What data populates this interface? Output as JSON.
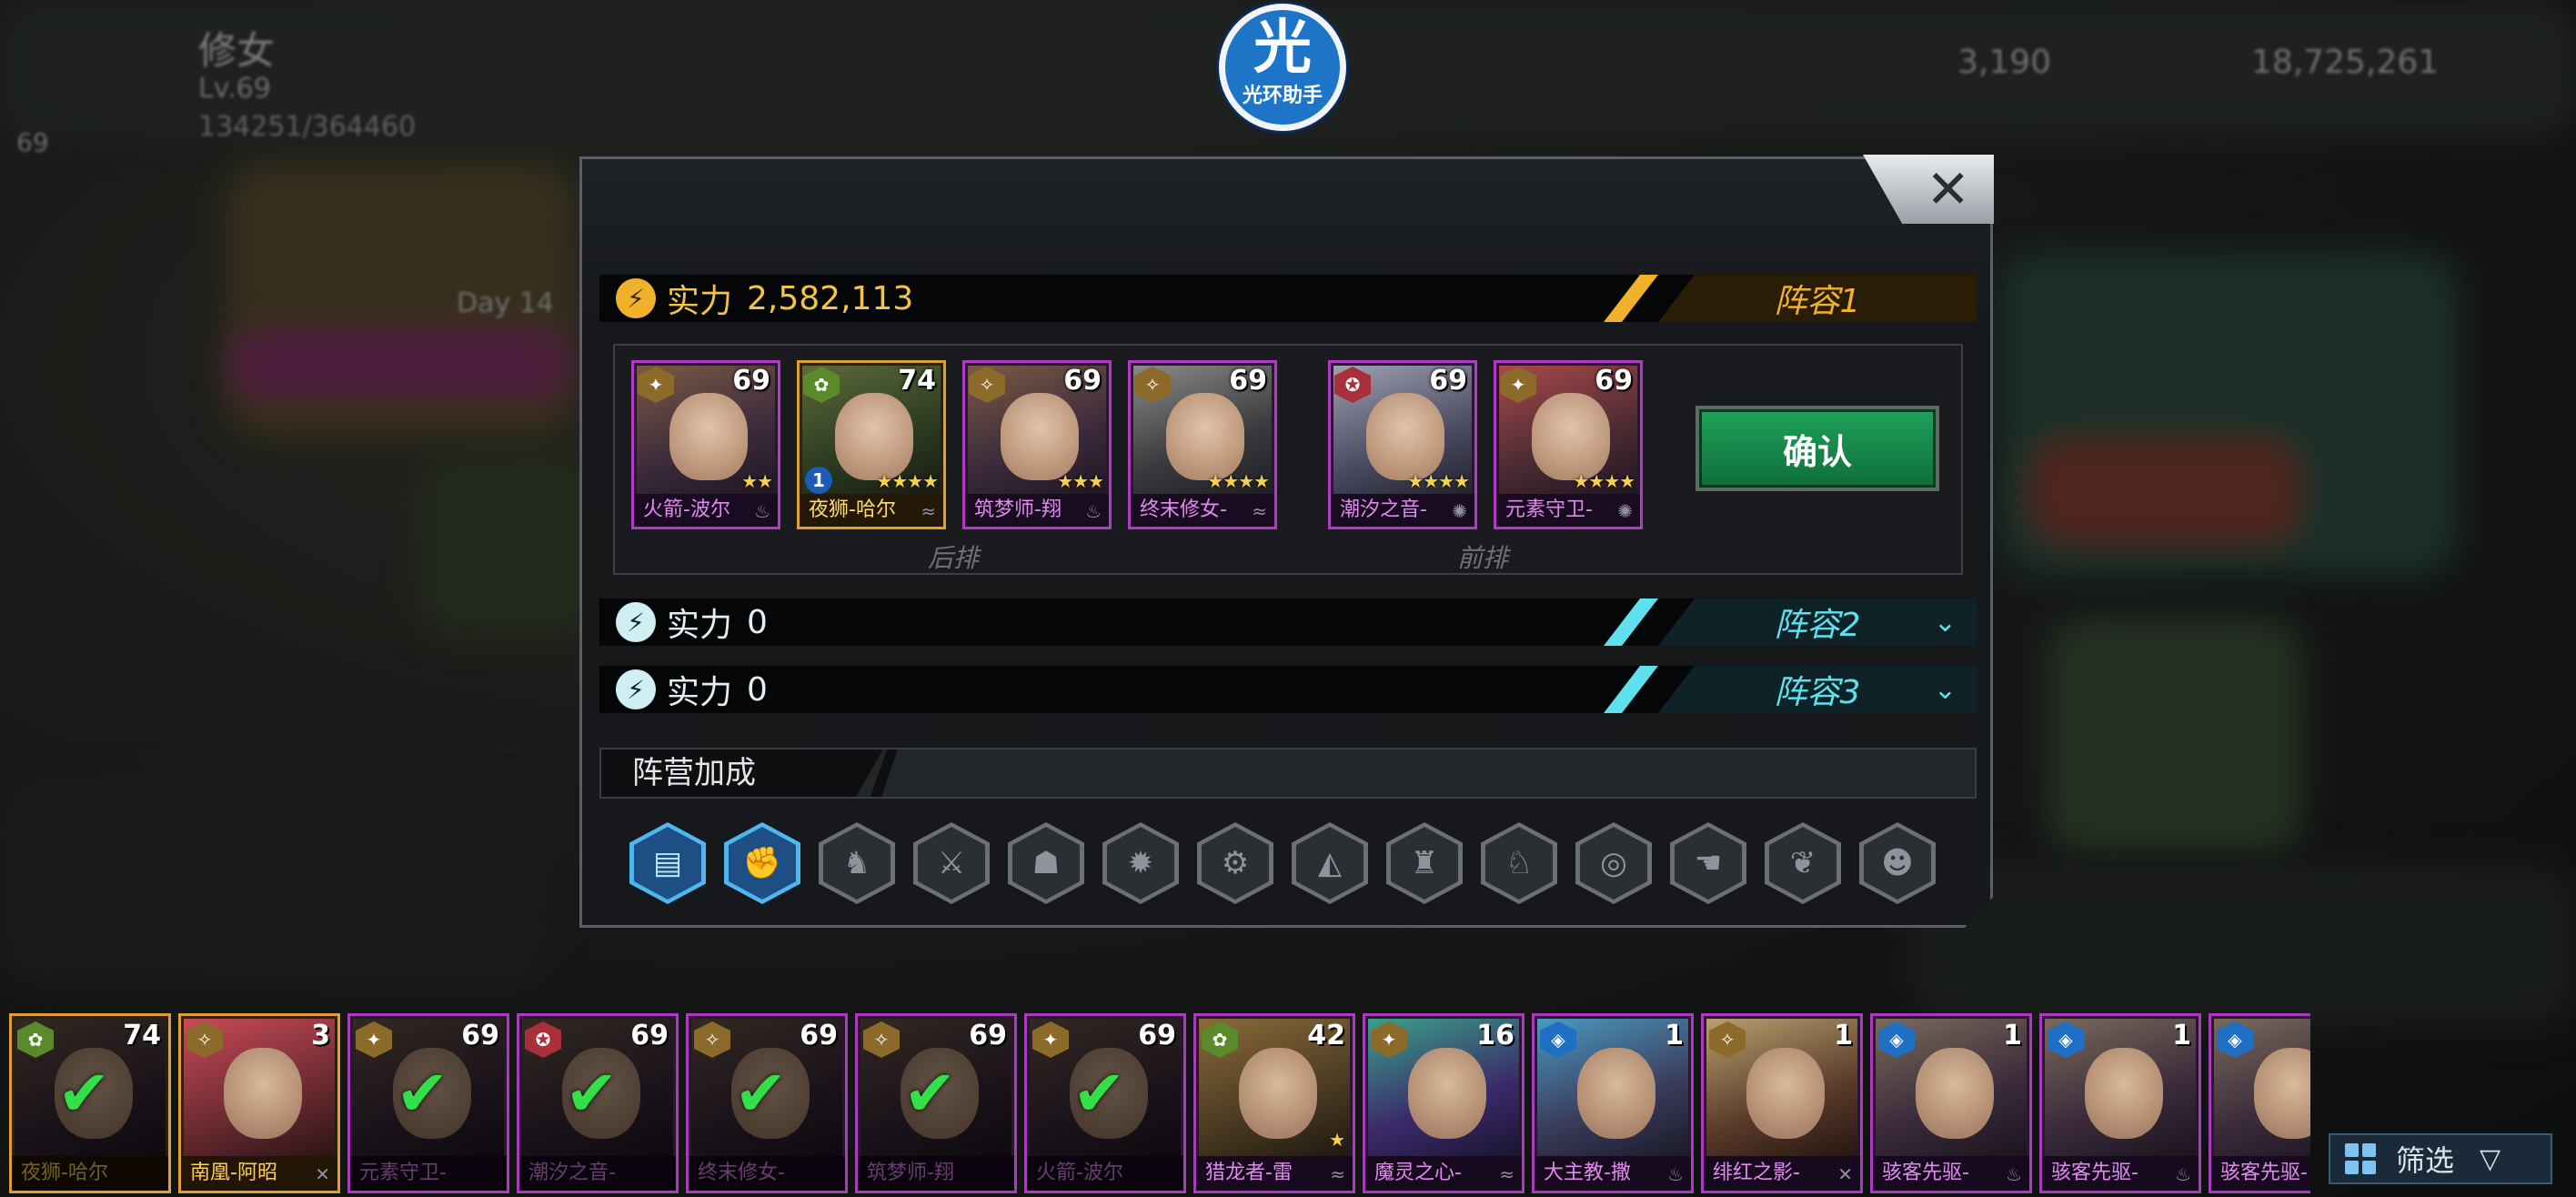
{
  "hud": {
    "player_name": "修女",
    "level": "Lv.69",
    "exp": "134251/364460",
    "badge_level": "69",
    "currency_1": "3,190",
    "currency_2": "18,725,261",
    "day": "Day 14"
  },
  "overlay_badge": {
    "char": "光",
    "label": "光环助手"
  },
  "modal": {
    "close_label": "✕",
    "power_label": "实力",
    "teams": [
      {
        "power": "2,582,113",
        "tab": "阵容1",
        "active": true
      },
      {
        "power": "0",
        "tab": "阵容2",
        "active": false
      },
      {
        "power": "0",
        "tab": "阵容3",
        "active": false
      }
    ],
    "lineup": {
      "back_row_label": "后排",
      "front_row_label": "前排",
      "heroes": [
        {
          "name": "火箭-波尔",
          "level": "69",
          "stars": "★★",
          "rarity": "purple"
        },
        {
          "name": "夜狮-哈尔",
          "level": "74",
          "stars": "★★★★",
          "rarity": "gold",
          "rank": "1"
        },
        {
          "name": "筑梦师-翔",
          "level": "69",
          "stars": "★★★",
          "rarity": "purple"
        },
        {
          "name": "终末修女-",
          "level": "69",
          "stars": "★★★★",
          "rarity": "purple"
        },
        {
          "name": "潮汐之音-",
          "level": "69",
          "stars": "★★★★",
          "rarity": "purple"
        },
        {
          "name": "元素守卫-",
          "level": "69",
          "stars": "★★★★",
          "rarity": "purple"
        }
      ]
    },
    "confirm_label": "确认",
    "faction_label": "阵营加成"
  },
  "roster": [
    {
      "name": "夜狮-哈尔",
      "level": "74",
      "used": true,
      "rarity": "gold-dim"
    },
    {
      "name": "南凰-阿昭",
      "level": "3",
      "used": false,
      "rarity": "gold"
    },
    {
      "name": "元素守卫-",
      "level": "69",
      "used": true
    },
    {
      "name": "潮汐之音-",
      "level": "69",
      "used": true
    },
    {
      "name": "终末修女-",
      "level": "69",
      "used": true
    },
    {
      "name": "筑梦师-翔",
      "level": "69",
      "used": true
    },
    {
      "name": "火箭-波尔",
      "level": "69",
      "used": true
    },
    {
      "name": "猎龙者-雷",
      "level": "42",
      "used": false
    },
    {
      "name": "魔灵之心-",
      "level": "16",
      "used": false
    },
    {
      "name": "大主教-撒",
      "level": "1",
      "used": false
    },
    {
      "name": "绯红之影-",
      "level": "1",
      "used": false
    },
    {
      "name": "骇客先驱-",
      "level": "1",
      "used": false
    },
    {
      "name": "骇客先驱-",
      "level": "1",
      "used": false
    },
    {
      "name": "骇客先驱-",
      "level": "",
      "used": false
    }
  ],
  "filter_label": "筛选",
  "colors": {
    "accent_gold": "#f1b12a",
    "accent_cyan": "#5fe0ef",
    "confirm_green": "#1a8f50",
    "hero_purple": "#b03cc3"
  }
}
